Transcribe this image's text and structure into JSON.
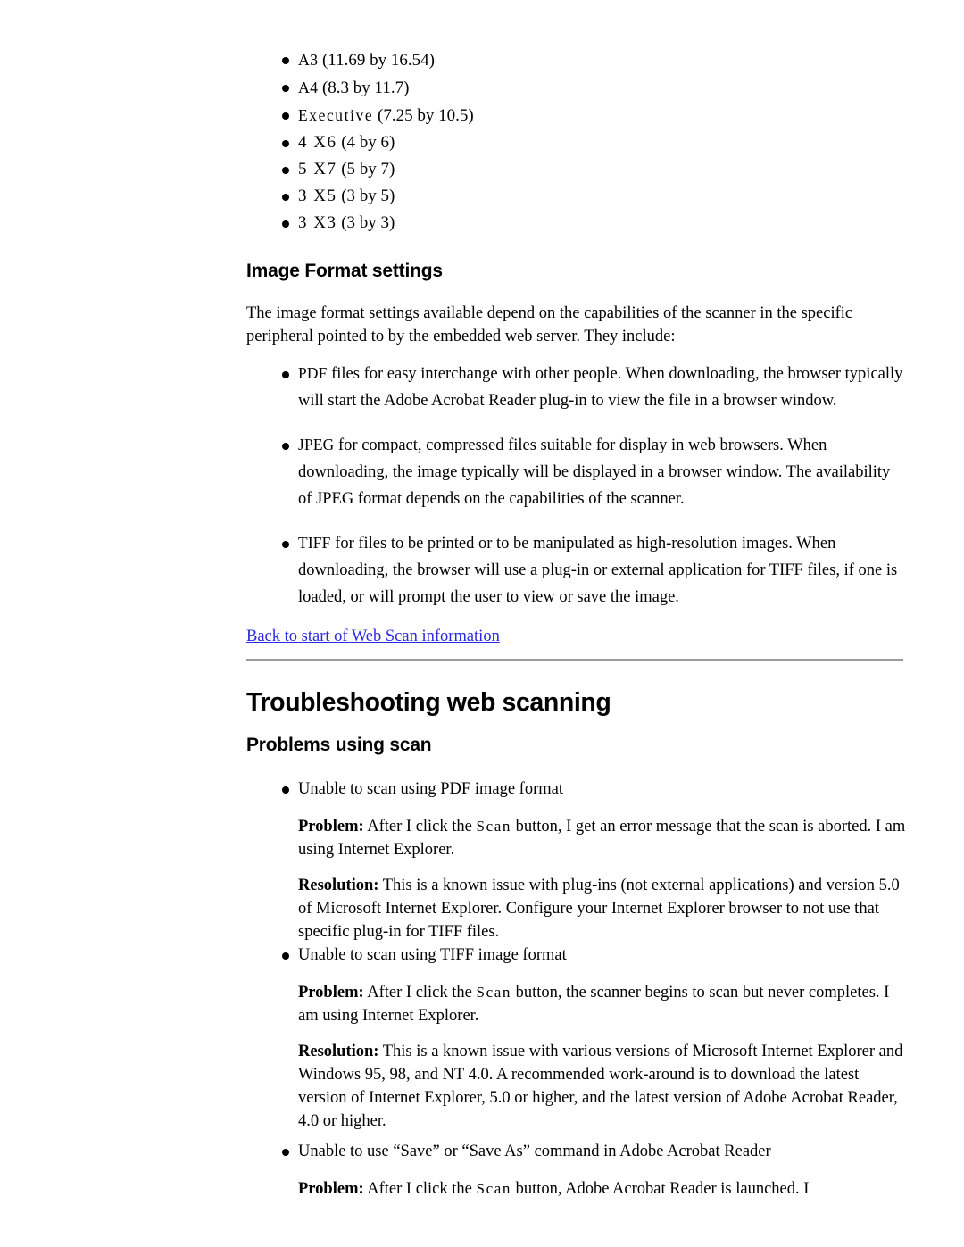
{
  "document": {
    "paper_sizes": [
      {
        "name": "A3",
        "name_style": "smallcaps",
        "dimensions": "(11.69 by 16.54)"
      },
      {
        "name": "A4",
        "name_style": "smallcaps",
        "dimensions": "(8.3 by 11.7)"
      },
      {
        "name": "Executive",
        "name_style": "spaced",
        "dimensions": "(7.25 by 10.5)"
      },
      {
        "name": "4 X6",
        "name_style": "lead-digit",
        "dimensions": "(4 by 6)"
      },
      {
        "name": "5 X7",
        "name_style": "lead-digit",
        "dimensions": "(5 by 7)"
      },
      {
        "name": "3 X5",
        "name_style": "lead-digit",
        "dimensions": "(3 by 5)"
      },
      {
        "name": "3 X3",
        "name_style": "lead-digit",
        "dimensions": "(3 by 3)"
      }
    ],
    "image_format": {
      "heading": "Image Format settings",
      "intro": "The image format settings available depend on the capabilities of the scanner in the specific peripheral pointed to by the embedded web server. They include:",
      "formats": [
        {
          "label": "PDF",
          "text": " files for easy interchange with other people. When downloading, the browser typically will start the Adobe Acrobat Reader plug-in to view the file in a browser window."
        },
        {
          "label": "JPEG",
          "text": " for compact, compressed files suitable for display in web browsers. When downloading, the image typically will be displayed in a browser window. The availability of JPEG format depends on the capabilities of the scanner."
        },
        {
          "label": "TIFF",
          "text": " for files to be printed or to be manipulated as high-resolution images. When downloading, the browser will use a plug-in or external application for TIFF files, if one is loaded, or will prompt the user to view or save the image."
        }
      ],
      "back_link": "Back to start of Web Scan information"
    },
    "troubleshooting": {
      "heading": "Troubleshooting web scanning",
      "subheading": "Problems using scan",
      "issues": [
        {
          "title": "Unable to scan using PDF image format",
          "problem_label": "Problem:",
          "problem_before": " After I click the ",
          "problem_button": "Scan",
          "problem_after": " button, I get an error message that the scan is aborted. I am using Internet Explorer.",
          "resolution_label": "Resolution:",
          "resolution_text": " This is a known issue with plug-ins (not external applications) and version 5.0 of Microsoft Internet Explorer. Configure your Internet Explorer browser to not use that specific plug-in for TIFF files."
        },
        {
          "title": "Unable to scan using TIFF image format",
          "problem_label": "Problem:",
          "problem_before": " After I click the ",
          "problem_button": "Scan",
          "problem_after": " button, the scanner begins to scan but never completes. I am using Internet Explorer.",
          "resolution_label": "Resolution:",
          "resolution_text": " This is a known issue with various versions of Microsoft Internet Explorer and Windows 95, 98, and NT 4.0. A recommended work-around is to download the latest version of Internet Explorer, 5.0 or higher, and the latest version of Adobe Acrobat Reader, 4.0 or higher."
        },
        {
          "title": "Unable to use “Save” or “Save As” command in Adobe Acrobat Reader",
          "problem_label": "Problem:",
          "problem_before": " After I click the ",
          "problem_button": "Scan",
          "problem_after": " button, Adobe Acrobat Reader is launched. I",
          "resolution_label": "",
          "resolution_text": ""
        }
      ]
    },
    "colors": {
      "text": "#000000",
      "link": "#2a2ae0",
      "rule_dark": "#9a9a9a",
      "rule_light": "#d8d8d8",
      "background": "#ffffff"
    }
  }
}
